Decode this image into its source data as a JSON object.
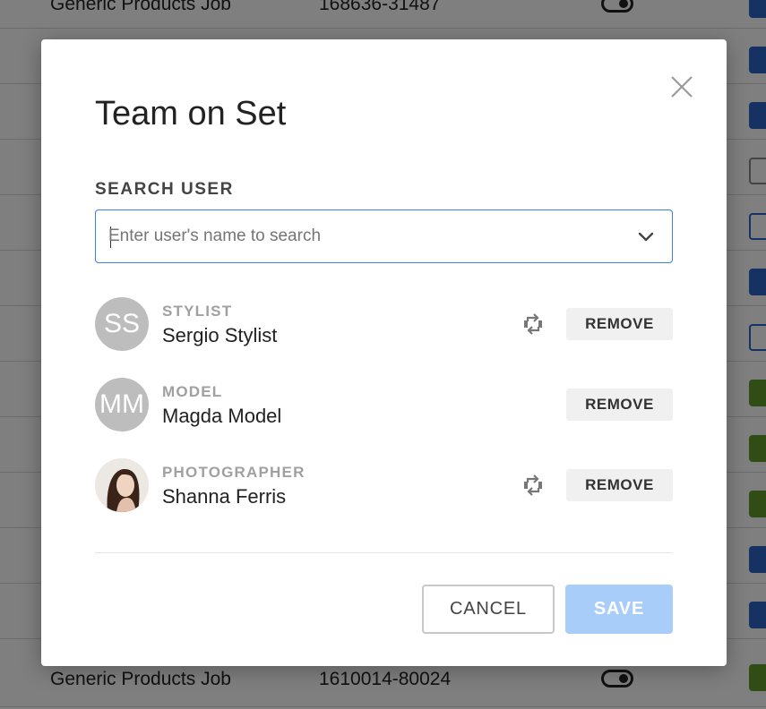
{
  "background": {
    "rows": [
      {
        "job": "Generic Products Job",
        "number": "168636-31487"
      },
      {
        "job": "Generic Products Job",
        "number": "1610014-80024"
      }
    ]
  },
  "modal": {
    "title": "Team on Set",
    "search": {
      "label": "SEARCH USER",
      "placeholder": "Enter user's name to search",
      "value": ""
    },
    "members": [
      {
        "initials": "SS",
        "role": "STYLIST",
        "name": "Sergio Stylist",
        "has_swap": true,
        "remove_label": "REMOVE"
      },
      {
        "initials": "MM",
        "role": "MODEL",
        "name": "Magda Model",
        "has_swap": false,
        "remove_label": "REMOVE"
      },
      {
        "initials": "",
        "role": "PHOTOGRAPHER",
        "name": "Shanna Ferris",
        "has_swap": true,
        "remove_label": "REMOVE",
        "avatar": "photo"
      }
    ],
    "cancel_label": "CANCEL",
    "save_label": "SAVE"
  },
  "colors": {
    "accent": "#3d7fd9",
    "save_disabled": "#a9cdf9",
    "role_text": "#a0a0a0",
    "avatar_bg": "#bdbdbd"
  },
  "icons": {
    "close": "close-icon",
    "dropdown": "chevron-down-icon",
    "swap": "swap-icon"
  }
}
